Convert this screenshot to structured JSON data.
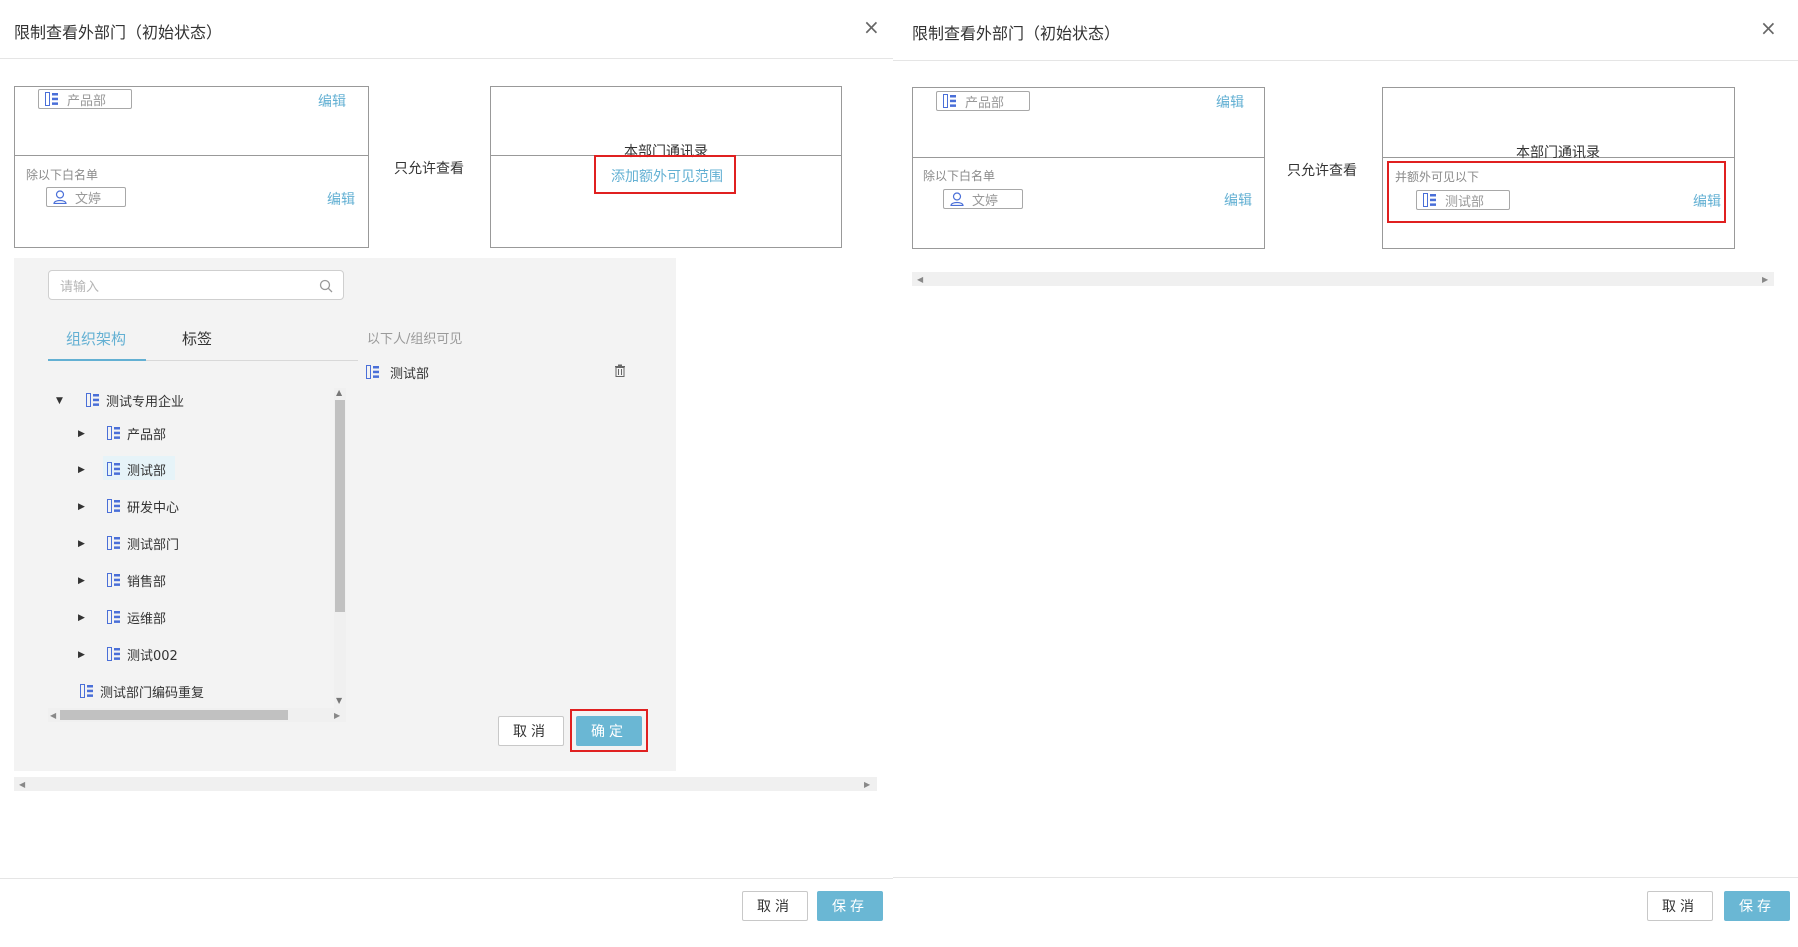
{
  "left": {
    "title": "限制查看外部门（初始状态）",
    "close_glyph": "×",
    "left_box": {
      "dept_tag": "产品部",
      "edit_top": "编辑",
      "whitelist_label": "除以下白名单",
      "user_tag": "文婷",
      "edit_bottom": "编辑"
    },
    "only_allow": "只允许查看",
    "right_box": {
      "header": "本部门通讯录",
      "add_link": "添加额外可见范围"
    },
    "picker": {
      "search_placeholder": "请输入",
      "tabs": [
        "组织架构",
        "标签"
      ],
      "visible_label": "以下人/组织可见",
      "selected_item": "测试部",
      "tree": [
        {
          "label": "测试专用企业",
          "caret": "down",
          "level": 0
        },
        {
          "label": "产品部",
          "caret": "right",
          "level": 1
        },
        {
          "label": "测试部",
          "caret": "right",
          "level": 1,
          "highlight": true
        },
        {
          "label": "研发中心",
          "caret": "right",
          "level": 1
        },
        {
          "label": "测试部门",
          "caret": "right",
          "level": 1
        },
        {
          "label": "销售部",
          "caret": "right",
          "level": 1
        },
        {
          "label": "运维部",
          "caret": "right",
          "level": 1
        },
        {
          "label": "测试002",
          "caret": "right",
          "level": 1
        },
        {
          "label": "测试部门编码重复",
          "caret": "none",
          "level": 0
        }
      ],
      "cancel": "取消",
      "confirm": "确定"
    },
    "footer": {
      "cancel": "取消",
      "save": "保存"
    }
  },
  "right": {
    "title": "限制查看外部门（初始状态）",
    "close_glyph": "×",
    "left_box": {
      "dept_tag": "产品部",
      "edit_top": "编辑",
      "whitelist_label": "除以下白名单",
      "user_tag": "文婷",
      "edit_bottom": "编辑"
    },
    "only_allow": "只允许查看",
    "right_box": {
      "header": "本部门通讯录",
      "extra_label": "并额外可见以下",
      "dept_tag": "测试部",
      "edit": "编辑"
    },
    "footer": {
      "cancel": "取消",
      "save": "保存"
    }
  },
  "colors": {
    "accent": "#63b0d3",
    "primary_button": "#6ab7d4",
    "highlight_red": "#e02020",
    "dept_icon": "#4a6fd8"
  }
}
